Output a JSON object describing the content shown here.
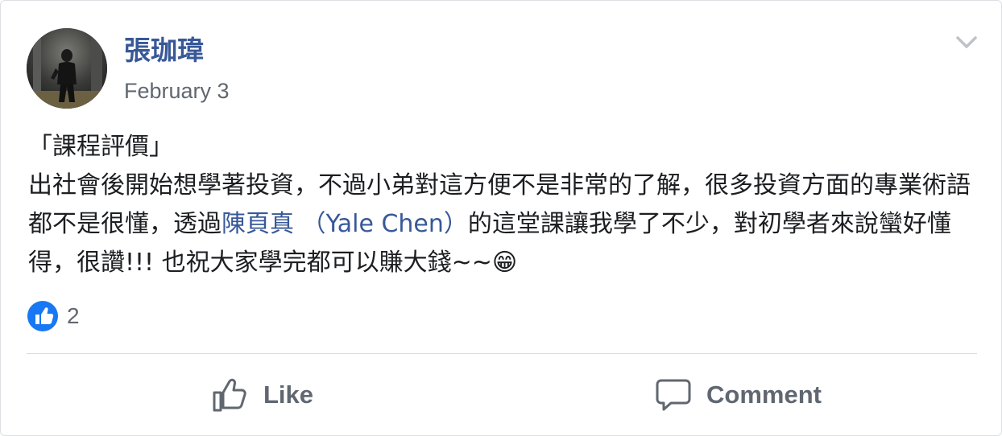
{
  "post": {
    "author": "張珈瑋",
    "date": "February 3",
    "text_line1": "「課程評價」",
    "text_part1": "出社會後開始想學著投資，不過小弟對這方便不是非常的了解，很多投資方面的專業術語都不是很懂，透過",
    "mention": "陳頁真 （Yale Chen）",
    "text_part2": "的這堂課讓我學了不少，對初學者來說蠻好懂得，很讚!!! 也祝大家學完都可以賺大錢~~",
    "emoji": "😁"
  },
  "reactions": {
    "icon": "like-icon",
    "count": "2",
    "color": "#1877f2"
  },
  "actions": {
    "like_label": "Like",
    "comment_label": "Comment"
  },
  "colors": {
    "author": "#385898",
    "mention": "#385898",
    "muted": "#606770"
  }
}
